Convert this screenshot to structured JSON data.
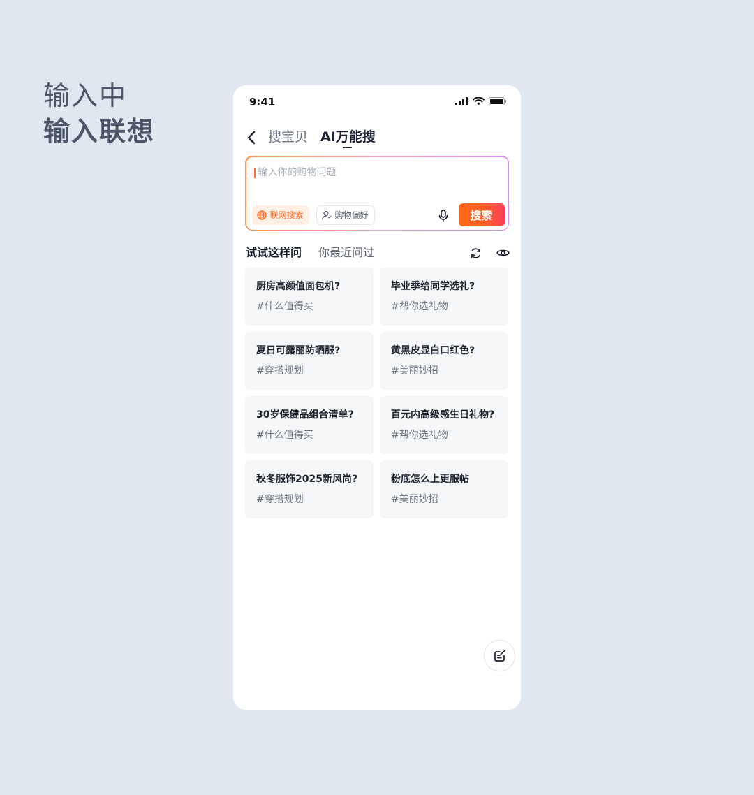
{
  "heading": {
    "line1": "输入中",
    "line2": "输入联想"
  },
  "status_bar": {
    "time": "9:41",
    "icons": [
      "signal-icon",
      "wifi-icon",
      "battery-icon"
    ]
  },
  "nav": {
    "back_icon": "chevron-left-icon",
    "tab_1": "搜宝贝",
    "tab_2": "AI万能搜",
    "active_tab": "AI万能搜"
  },
  "search": {
    "placeholder": "输入你的购物问题",
    "value": "",
    "chip_web": "联网搜索",
    "chip_pref": "购物偏好",
    "search_button": "搜索"
  },
  "sections": {
    "tab_1": "试试这样问",
    "tab_2": "你最近问过",
    "active": "试试这样问"
  },
  "suggestions": [
    {
      "title": "厨房高颜值面包机?",
      "tag": "#什么值得买"
    },
    {
      "title": "毕业季给同学选礼?",
      "tag": "#帮你选礼物"
    },
    {
      "title": "夏日可露丽防晒服?",
      "tag": "#穿搭规划"
    },
    {
      "title": "黄黑皮显白口红色?",
      "tag": "#美丽妙招"
    },
    {
      "title": "30岁保健品组合清单?",
      "tag": "#什么值得买"
    },
    {
      "title": "百元内高级感生日礼物?",
      "tag": "#帮你选礼物"
    },
    {
      "title": "秋冬服饰2025新风尚?",
      "tag": "#穿搭规划"
    },
    {
      "title": "粉底怎么上更服帖",
      "tag": "#美丽妙招"
    }
  ],
  "colors": {
    "accent": "#ff6a26",
    "background": "#e1e7ef",
    "card": "#f5f6f8"
  }
}
